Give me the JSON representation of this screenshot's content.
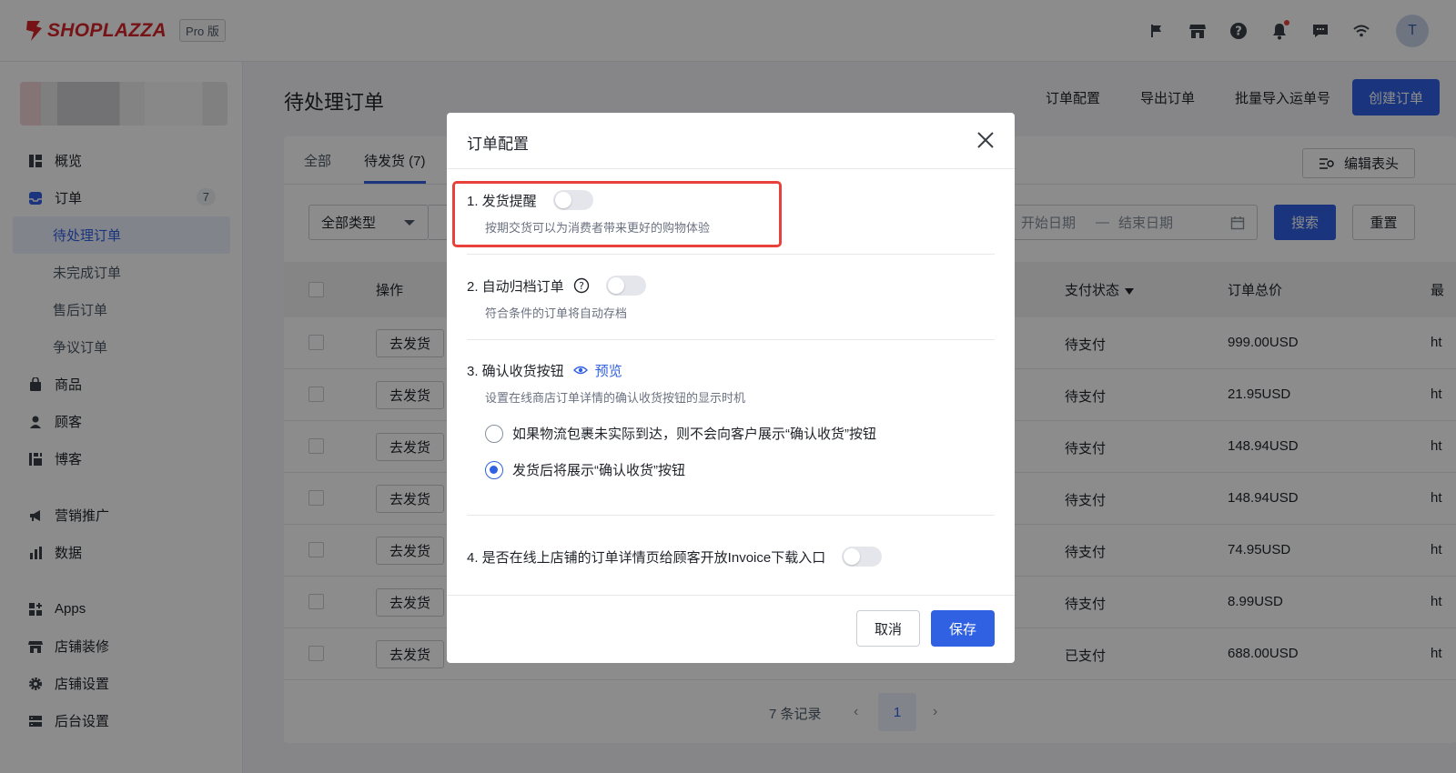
{
  "brand": {
    "name": "SHOPLAZZA",
    "plan": "Pro 版",
    "logo_color": "#d8232a"
  },
  "topbar": {
    "icons": [
      "flag-icon",
      "store-icon",
      "help-icon",
      "bell-icon",
      "chat-icon",
      "wifi-icon"
    ],
    "avatar_initial": "T"
  },
  "sidebar": {
    "items": [
      {
        "label": "概览",
        "icon": "dashboard-icon"
      },
      {
        "label": "订单",
        "icon": "inbox-icon",
        "count": "7"
      },
      {
        "label": "待处理订单"
      },
      {
        "label": "未完成订单"
      },
      {
        "label": "售后订单"
      },
      {
        "label": "争议订单"
      },
      {
        "label": "商品",
        "icon": "bag-icon"
      },
      {
        "label": "顾客",
        "icon": "person-icon"
      },
      {
        "label": "博客",
        "icon": "blog-icon"
      },
      {
        "label": "营销推广",
        "icon": "megaphone-icon"
      },
      {
        "label": "数据",
        "icon": "chart-icon"
      },
      {
        "label": "Apps",
        "icon": "apps-icon"
      },
      {
        "label": "店铺装修",
        "icon": "storefront-icon"
      },
      {
        "label": "店铺设置",
        "icon": "gear-icon"
      },
      {
        "label": "后台设置",
        "icon": "server-icon"
      }
    ]
  },
  "main": {
    "title": "待处理订单",
    "actions": {
      "config": "订单配置",
      "export": "导出订单",
      "import": "批量导入运单号",
      "create": "创建订单"
    },
    "tabs": [
      "全部",
      "待发货 (7)"
    ],
    "edit_header": "编辑表头",
    "filter": {
      "type": "全部类型",
      "date_start": "开始日期",
      "date_sep": "—",
      "date_end": "结束日期",
      "search": "搜索",
      "reset": "重置"
    },
    "table": {
      "columns": {
        "action": "操作",
        "payment_status": "支付状态",
        "total": "订单总价",
        "last": "最"
      },
      "action_label": "去发货",
      "rows": [
        {
          "status": "待支付",
          "total": "999.00USD",
          "last": "ht"
        },
        {
          "status": "待支付",
          "total": "21.95USD",
          "last": "ht"
        },
        {
          "status": "待支付",
          "total": "148.94USD",
          "last": "ht"
        },
        {
          "status": "待支付",
          "total": "148.94USD",
          "last": "ht"
        },
        {
          "status": "待支付",
          "total": "74.95USD",
          "last": "ht"
        },
        {
          "status": "待支付",
          "total": "8.99USD",
          "last": "ht"
        },
        {
          "status": "已支付",
          "total": "688.00USD",
          "last": "ht"
        }
      ]
    },
    "pager": {
      "total": "7 条记录",
      "current_page": "1",
      "prev": "‹",
      "next": "›"
    }
  },
  "modal": {
    "title": "订单配置",
    "settings": [
      {
        "title": "1. 发货提醒",
        "desc": "按期交货可以为消费者带来更好的购物体验",
        "enabled": false
      },
      {
        "title": "2. 自动归档订单",
        "desc": "符合条件的订单将自动存档",
        "enabled": false
      },
      {
        "title": "3. 确认收货按钮",
        "preview": "预览",
        "desc": "设置在线商店订单详情的确认收货按钮的显示时机"
      },
      {
        "title": "4. 是否在线上店铺的订单详情页给顾客开放Invoice下载入口",
        "enabled": false
      }
    ],
    "radio_options": [
      {
        "label": "如果物流包裹未实际到达，则不会向客户展示“确认收货”按钮",
        "checked": false
      },
      {
        "label": "发货后将展示“确认收货”按钮",
        "checked": true
      }
    ],
    "cancel": "取消",
    "save": "保存"
  },
  "colors": {
    "primary": "#3061e3",
    "highlight": "#e8413b",
    "mask": "rgba(0,0,0,0.45)"
  }
}
